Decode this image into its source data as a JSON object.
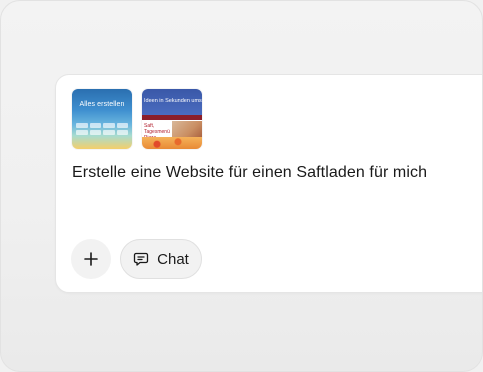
{
  "attachments": [
    {
      "name": "thumbnail-alles-erstellen",
      "title": "Alles erstellen"
    },
    {
      "name": "thumbnail-ideen-umsetzen",
      "title": "Ideen in Sekunden umsetzen",
      "subtitle": "Saft, Tagesmenü Pizza"
    }
  ],
  "prompt": {
    "text": "Erstelle eine Website für einen Saftladen für mich"
  },
  "actions": {
    "add_icon": "plus-icon",
    "chat_icon": "chat-bubble-icon",
    "chat_label": "Chat"
  },
  "colors": {
    "card_background": "#ffffff",
    "page_background": "#f1f1f1",
    "button_background": "#f2f2f2",
    "text": "#1a1a1a"
  }
}
